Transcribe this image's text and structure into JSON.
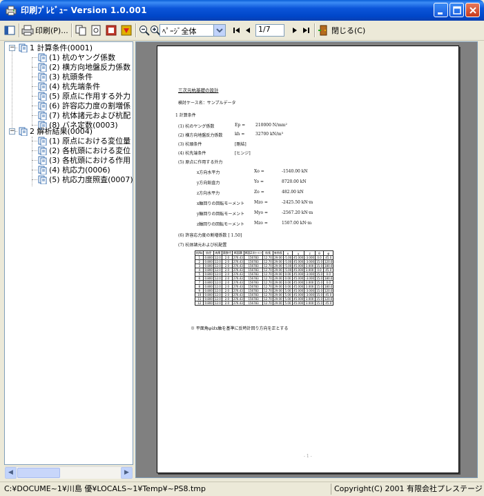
{
  "window": {
    "title": "印刷ﾌﾟﾚﾋﾞｭｰ  Version 1.0.001"
  },
  "toolbar": {
    "print_label": "印刷(P)...",
    "zoom_value": "ﾍﾟｰｼﾞ全体",
    "page_value": "1/7",
    "close_label": "閉じる(C)"
  },
  "tree": {
    "groups": [
      {
        "label": "1 計算条件(0001)",
        "children": [
          "(1) 杭のヤング係数",
          "(2) 横方向地盤反力係数",
          "(3) 杭頭条件",
          "(4) 杭先端条件",
          "(5) 原点に作用する外力",
          "(6) 許容応力度の割増係",
          "(7) 杭体諸元および杭配",
          "(8) バネ定数(0003)"
        ]
      },
      {
        "label": "2 解析結果(0004)",
        "children": [
          "(1) 原点における変位量",
          "(2) 各杭頭における変位",
          "(3) 各杭頭における作用",
          "(4) 杭応力(0006)",
          "(5) 杭応力度照査(0007)"
        ]
      }
    ]
  },
  "document": {
    "heading": "三次元杭基礎の設計",
    "case_line": "検討ケース名：サンプルデータ",
    "section": "1 計算条件",
    "items": [
      {
        "label": "(1) 杭のヤング係数",
        "sym": "Ep =",
        "val": "210000 N/mm²"
      },
      {
        "label": "(2) 横方向地盤反力係数",
        "sym": "kh =",
        "val": "32700 kN/m³"
      },
      {
        "label": "(3) 杭頭条件",
        "sym": "",
        "val": "[剛結]"
      },
      {
        "label": "(4) 杭先端条件",
        "sym": "",
        "val": "[ヒンジ]"
      },
      {
        "label": "(5) 原点に作用する外力",
        "sym": "",
        "val": ""
      }
    ],
    "forces": [
      {
        "label": "x方向水平力",
        "sym": "Xo =",
        "val": "-1540.00 kN"
      },
      {
        "label": "y方向鉛直力",
        "sym": "Yo =",
        "val": "8720.00 kN"
      },
      {
        "label": "z方向水平力",
        "sym": "Zo =",
        "val": "482.00 kN"
      },
      {
        "label": "x軸回りの回転モーメント",
        "sym": "Mzo =",
        "val": "-2425.50 kN·m"
      },
      {
        "label": "y軸回りの回転モーメント",
        "sym": "Myo =",
        "val": "-2567.20 kN·m"
      },
      {
        "label": "z軸回りの回転モーメント",
        "sym": "Mzo =",
        "val": "1507.00 kN·m"
      }
    ],
    "item6": "(6) 許容応力度の割増係数 [ 1.50]",
    "item7": "(7) 杭体諸元および杭配置",
    "table_headers": [
      "杭No",
      "杭径",
      "肉厚",
      "腐食代",
      "断面積",
      "断面2次ﾓｰﾒﾝﾄ",
      "杭長",
      "有効長",
      "x",
      "y",
      "z",
      "θ",
      "φ"
    ],
    "table_rows": [
      [
        "1",
        "0.800",
        "12.0",
        "2.0",
        "276.43",
        "156783",
        "12.70",
        "29.00",
        "-5.00",
        "45.000",
        "-3.000",
        "0.0",
        "45.0"
      ],
      [
        "2",
        "0.800",
        "12.0",
        "2.0",
        "276.43",
        "156783",
        "12.70",
        "29.00",
        "-5.00",
        "45.000",
        "-3.000",
        "15.0",
        "120.0"
      ],
      [
        "3",
        "0.800",
        "12.0",
        "2.0",
        "276.43",
        "156783",
        "12.70",
        "29.00",
        "-5.00",
        "45.000",
        "3.000",
        "15.0",
        "180.0"
      ],
      [
        "4",
        "0.800",
        "12.0",
        "2.0",
        "276.43",
        "156783",
        "12.70",
        "29.00",
        "-5.00",
        "45.000",
        "3.000",
        "0.0",
        "45.0"
      ],
      [
        "5",
        "0.800",
        "12.0",
        "2.0",
        "276.43",
        "156783",
        "12.70",
        "29.00",
        "0.00",
        "45.000",
        "-3.000",
        "15.0",
        "0.0"
      ],
      [
        "6",
        "0.800",
        "12.0",
        "2.0",
        "276.43",
        "156783",
        "12.70",
        "29.00",
        "0.00",
        "45.000",
        "-3.000",
        "15.0",
        "180.0"
      ],
      [
        "7",
        "0.800",
        "12.0",
        "2.0",
        "276.43",
        "156783",
        "12.70",
        "29.00",
        "0.00",
        "45.000",
        "3.000",
        "15.0",
        "0.0"
      ],
      [
        "8",
        "0.800",
        "12.0",
        "2.0",
        "276.43",
        "156783",
        "12.70",
        "29.00",
        "0.00",
        "45.000",
        "3.000",
        "15.0",
        "180.0"
      ],
      [
        "9",
        "0.800",
        "12.0",
        "2.0",
        "276.43",
        "156783",
        "12.70",
        "29.00",
        "5.00",
        "45.000",
        "-3.000",
        "15.0",
        "120.0"
      ],
      [
        "10",
        "0.800",
        "12.0",
        "2.0",
        "276.43",
        "156783",
        "12.70",
        "29.00",
        "5.00",
        "45.000",
        "-3.000",
        "15.0",
        "45.0"
      ],
      [
        "11",
        "0.800",
        "12.0",
        "2.0",
        "276.43",
        "156783",
        "12.70",
        "29.00",
        "5.00",
        "45.000",
        "3.000",
        "15.0",
        "120.0"
      ],
      [
        "12",
        "0.800",
        "12.0",
        "2.0",
        "276.43",
        "156783",
        "12.70",
        "29.00",
        "5.00",
        "45.000",
        "3.000",
        "15.0",
        "45.0"
      ]
    ],
    "footnote": "※ 平面角φはx軸を基準に反時計回り方向を正とする",
    "page_footer": "- 1 -"
  },
  "status": {
    "path": "C:¥DOCUME~1¥川島 優¥LOCALS~1¥Temp¥~PS8.tmp",
    "copyright": "Copyright(C) 2001 有限会社プレステージ"
  },
  "colors": {
    "titlebar": "#0a5fd8",
    "preview_bg": "#808080",
    "window_bg": "#ece9d8"
  }
}
